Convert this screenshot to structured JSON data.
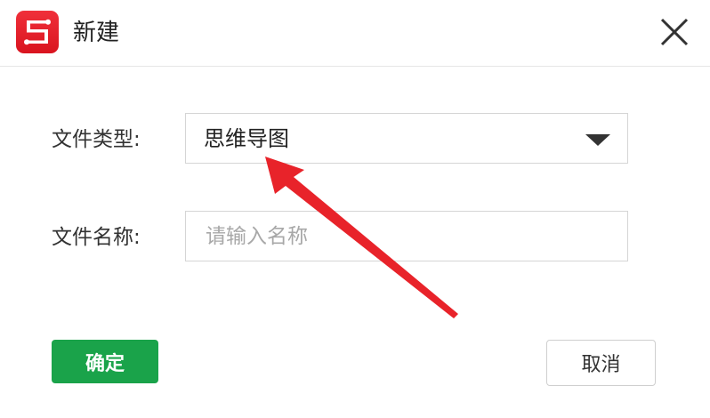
{
  "window": {
    "title": "新建",
    "app_icon": "app-logo-icon",
    "close_icon": "close-icon"
  },
  "form": {
    "file_type_label": "文件类型:",
    "file_type_value": "思维导图",
    "file_name_label": "文件名称:",
    "file_name_value": "",
    "file_name_placeholder": "请输入名称"
  },
  "buttons": {
    "ok_label": "确定",
    "cancel_label": "取消"
  },
  "colors": {
    "ok_button": "#1aa34a",
    "app_icon": "#e8202a",
    "annotation_arrow": "#e8232a"
  }
}
